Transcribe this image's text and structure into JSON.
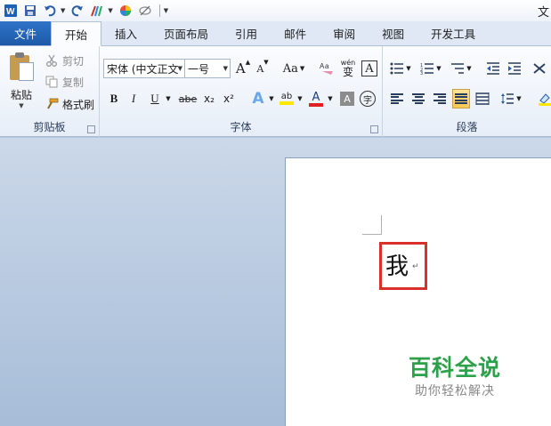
{
  "window": {
    "title_fragment": "文"
  },
  "tabs": [
    {
      "label": "文件"
    },
    {
      "label": "开始"
    },
    {
      "label": "插入"
    },
    {
      "label": "页面布局"
    },
    {
      "label": "引用"
    },
    {
      "label": "邮件"
    },
    {
      "label": "审阅"
    },
    {
      "label": "视图"
    },
    {
      "label": "开发工具"
    }
  ],
  "ribbon": {
    "clipboard": {
      "label": "剪贴板",
      "paste": "粘贴",
      "cut": "剪切",
      "copy": "复制",
      "format_painter": "格式刷"
    },
    "font": {
      "label": "字体",
      "font_name": "宋体 (中文正文",
      "font_size": "一号",
      "grow": "A",
      "shrink": "A",
      "change_case": "Aa",
      "phonetic": "wén",
      "phonetic_char": "变",
      "border_char": "A",
      "bold": "B",
      "italic": "I",
      "underline": "U",
      "strike": "abe",
      "subscript": "x₂",
      "superscript": "x²",
      "text_effect": "A",
      "highlight": "ab",
      "font_color": "A",
      "shading": "A",
      "enclose": "字"
    },
    "paragraph": {
      "label": "段落"
    }
  },
  "document": {
    "text": "我",
    "watermark_title": "百科全说",
    "watermark_subtitle": "助你轻松解决"
  },
  "colors": {
    "file_tab": "#2f73c8",
    "highlight_box": "#d9302c",
    "watermark_green": "#2da14a",
    "font_color_bar": "#e02020",
    "highlight_bar": "#ffe800"
  }
}
